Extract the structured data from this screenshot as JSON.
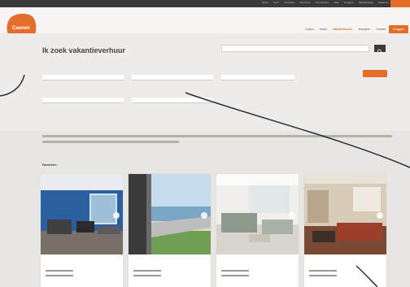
{
  "topbar": {
    "links": [
      "Home",
      "Sport",
      "Voordelen",
      "Recreatie",
      "Overnachten",
      "Reis",
      "Veelgest.",
      "Maatschappij",
      "Vacatures"
    ]
  },
  "brand": {
    "name": "Caenen",
    "tagline": "",
    "accent": "#e46d2c"
  },
  "nav": {
    "items": [
      "Kopen",
      "Huren",
      "Vakantiehuren",
      "Verkopen",
      "Contact"
    ],
    "active_index": 2,
    "cta_label": "Inloggen"
  },
  "search_page": {
    "title": "Ik zoek vakantieverhuur",
    "top_search_placeholder": ""
  },
  "form": {
    "fields": [
      {
        "label": "",
        "placeholder": ""
      },
      {
        "label": "",
        "placeholder": ""
      },
      {
        "label": "",
        "placeholder": ""
      },
      {
        "label": "",
        "placeholder": ""
      },
      {
        "label": "",
        "placeholder": ""
      }
    ],
    "submit_label": "",
    "filters": [
      "",
      "",
      "",
      ""
    ]
  },
  "results": {
    "heading": "Favorieten",
    "count_label": "",
    "cards": [
      {
        "price": "",
        "date": ""
      },
      {
        "price": "",
        "date": ""
      },
      {
        "price": "",
        "date": ""
      },
      {
        "price": "",
        "date": ""
      }
    ]
  },
  "icons": {
    "search": "search-icon",
    "next": "chevron-right-icon"
  }
}
